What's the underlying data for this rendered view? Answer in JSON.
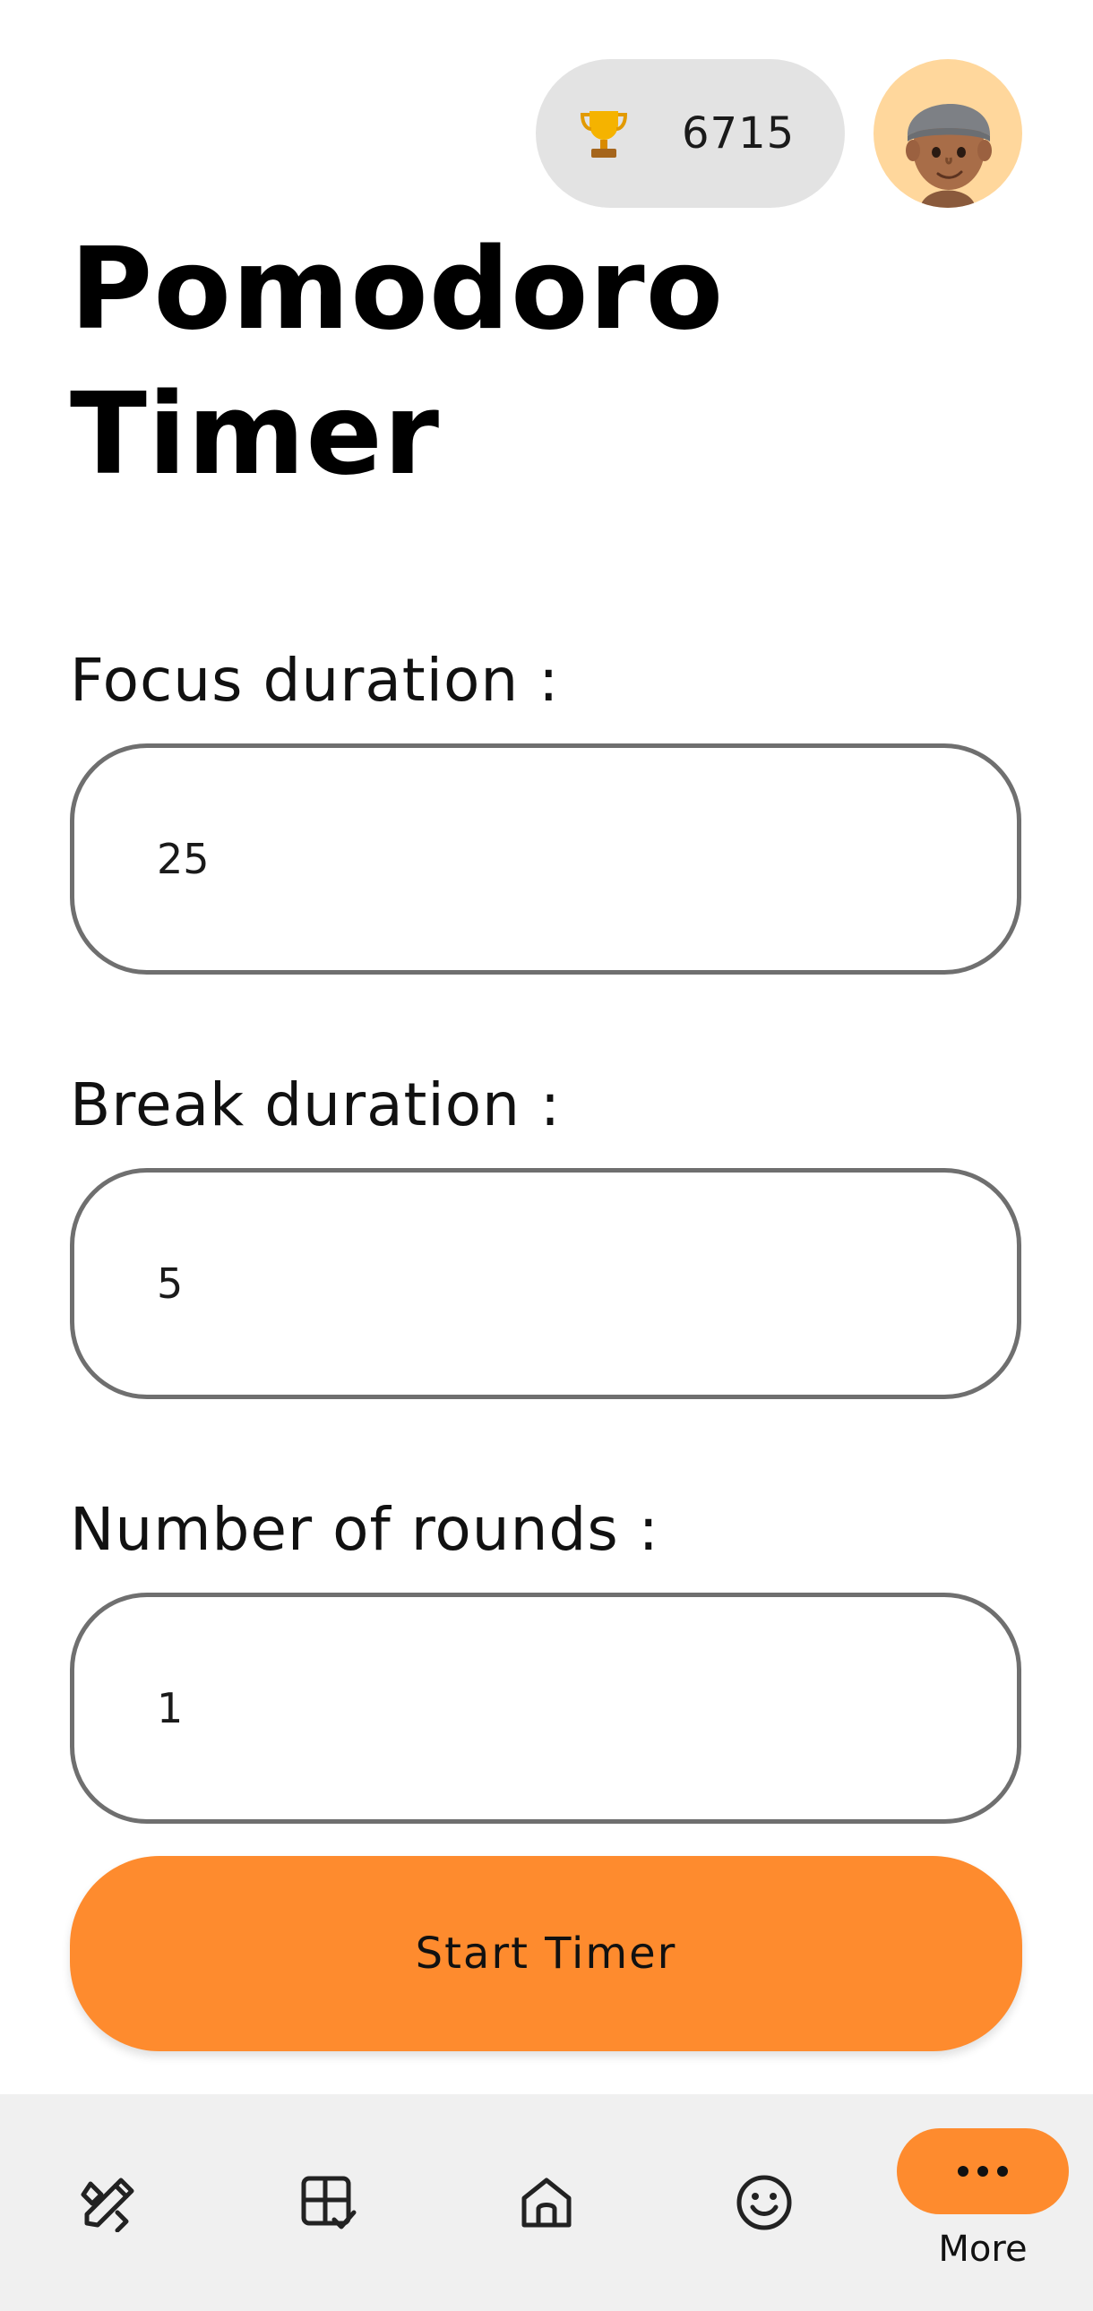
{
  "header": {
    "score": "6715",
    "score_icon": "trophy-icon",
    "avatar_icon": "avatar"
  },
  "title": {
    "line1": "Pomodoro",
    "line2": "Timer"
  },
  "fields": {
    "focus": {
      "label": "Focus duration :",
      "value": "25"
    },
    "break": {
      "label": "Break duration :",
      "value": "5"
    },
    "rounds": {
      "label": "Number of rounds :",
      "value": "1"
    }
  },
  "start_button": {
    "label": "Start Timer"
  },
  "bottom_nav": {
    "items": [
      {
        "icon": "tools-icon"
      },
      {
        "icon": "tasks-icon"
      },
      {
        "icon": "home-icon"
      },
      {
        "icon": "smiley-icon"
      },
      {
        "icon": "more-dots-icon",
        "label": "More"
      }
    ]
  },
  "colors": {
    "accent": "#fe8b2e",
    "pill_bg": "#e3e3e3",
    "avatar_bg": "#ffd79c",
    "nav_bg": "#f0f0f0",
    "field_border": "#6f6f6f"
  }
}
